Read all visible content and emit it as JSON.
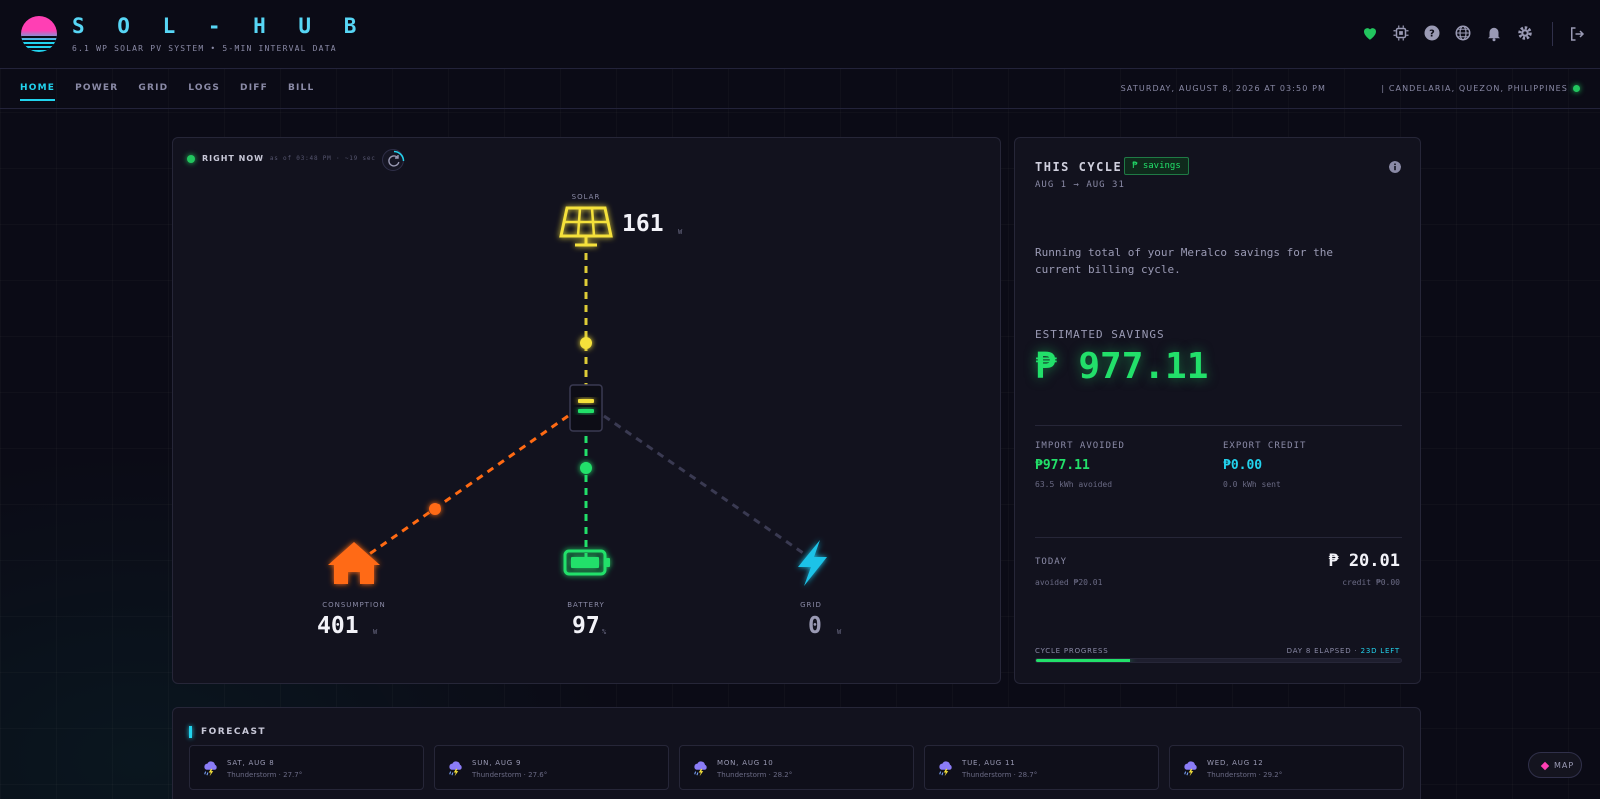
{
  "header": {
    "title": "S O L - H U B",
    "subtitle": "6.1 WP SOLAR PV SYSTEM  •  5-MIN INTERVAL DATA",
    "icons": [
      "heart-icon",
      "chip-icon",
      "help-icon",
      "globe-icon",
      "bell-icon",
      "gear-icon",
      "logout-icon"
    ]
  },
  "nav": {
    "items": [
      "HOME",
      "POWER",
      "GRID",
      "LOGS",
      "DIFF",
      "BILL"
    ],
    "active": "HOME",
    "date": "SATURDAY, AUGUST 8, 2026 AT 03:50 PM",
    "location": "| CANDELARIA, QUEZON, PHILIPPINES"
  },
  "flow": {
    "status_label": "RIGHT NOW",
    "status_time": "· as of 03:48 PM · ~19 sec",
    "solar": {
      "label": "SOLAR",
      "value": "161",
      "unit": "W"
    },
    "consumption": {
      "label": "CONSUMPTION",
      "value": "401",
      "unit": "W"
    },
    "battery": {
      "label": "BATTERY",
      "value": "97",
      "unit": "%"
    },
    "grid": {
      "label": "GRID",
      "value": "0",
      "unit": "W"
    },
    "colors": {
      "solar": "#f5e13a",
      "consumption": "#ff6a13",
      "battery": "#22e06a",
      "grid": "#1cc3e8",
      "idle": "#3a3a52"
    }
  },
  "cycle": {
    "title": "THIS CYCLE",
    "badge": "₱ savings",
    "range": "AUG 1 → AUG 31",
    "description": "Running total of your Meralco savings for the current billing cycle.",
    "estimated_label": "ESTIMATED SAVINGS",
    "estimated_value": "₱ 977.11",
    "import_avoided": {
      "label": "IMPORT AVOIDED",
      "value": "₱977.11",
      "sub": "63.5 kWh avoided"
    },
    "export_credit": {
      "label": "EXPORT CREDIT",
      "value": "₱0.00",
      "sub": "0.0 kWh sent"
    },
    "today": {
      "label": "TODAY",
      "value": "₱ 20.01",
      "avoided": "avoided ₱20.01",
      "credit": "credit ₱0.00"
    },
    "progress": {
      "label": "CYCLE PROGRESS",
      "elapsed": "DAY 8 ELAPSED ·",
      "left": "23D LEFT",
      "fraction": 0.258
    }
  },
  "forecast": {
    "title": "FORECAST",
    "days": [
      {
        "day": "SAT, AUG 8",
        "condition": "Thunderstorm · 27.7°"
      },
      {
        "day": "SUN, AUG 9",
        "condition": "Thunderstorm · 27.6°"
      },
      {
        "day": "MON, AUG 10",
        "condition": "Thunderstorm · 28.2°"
      },
      {
        "day": "TUE, AUG 11",
        "condition": "Thunderstorm · 28.7°"
      },
      {
        "day": "WED, AUG 12",
        "condition": "Thunderstorm · 29.2°"
      }
    ]
  },
  "map_button": {
    "label": "MAP"
  }
}
